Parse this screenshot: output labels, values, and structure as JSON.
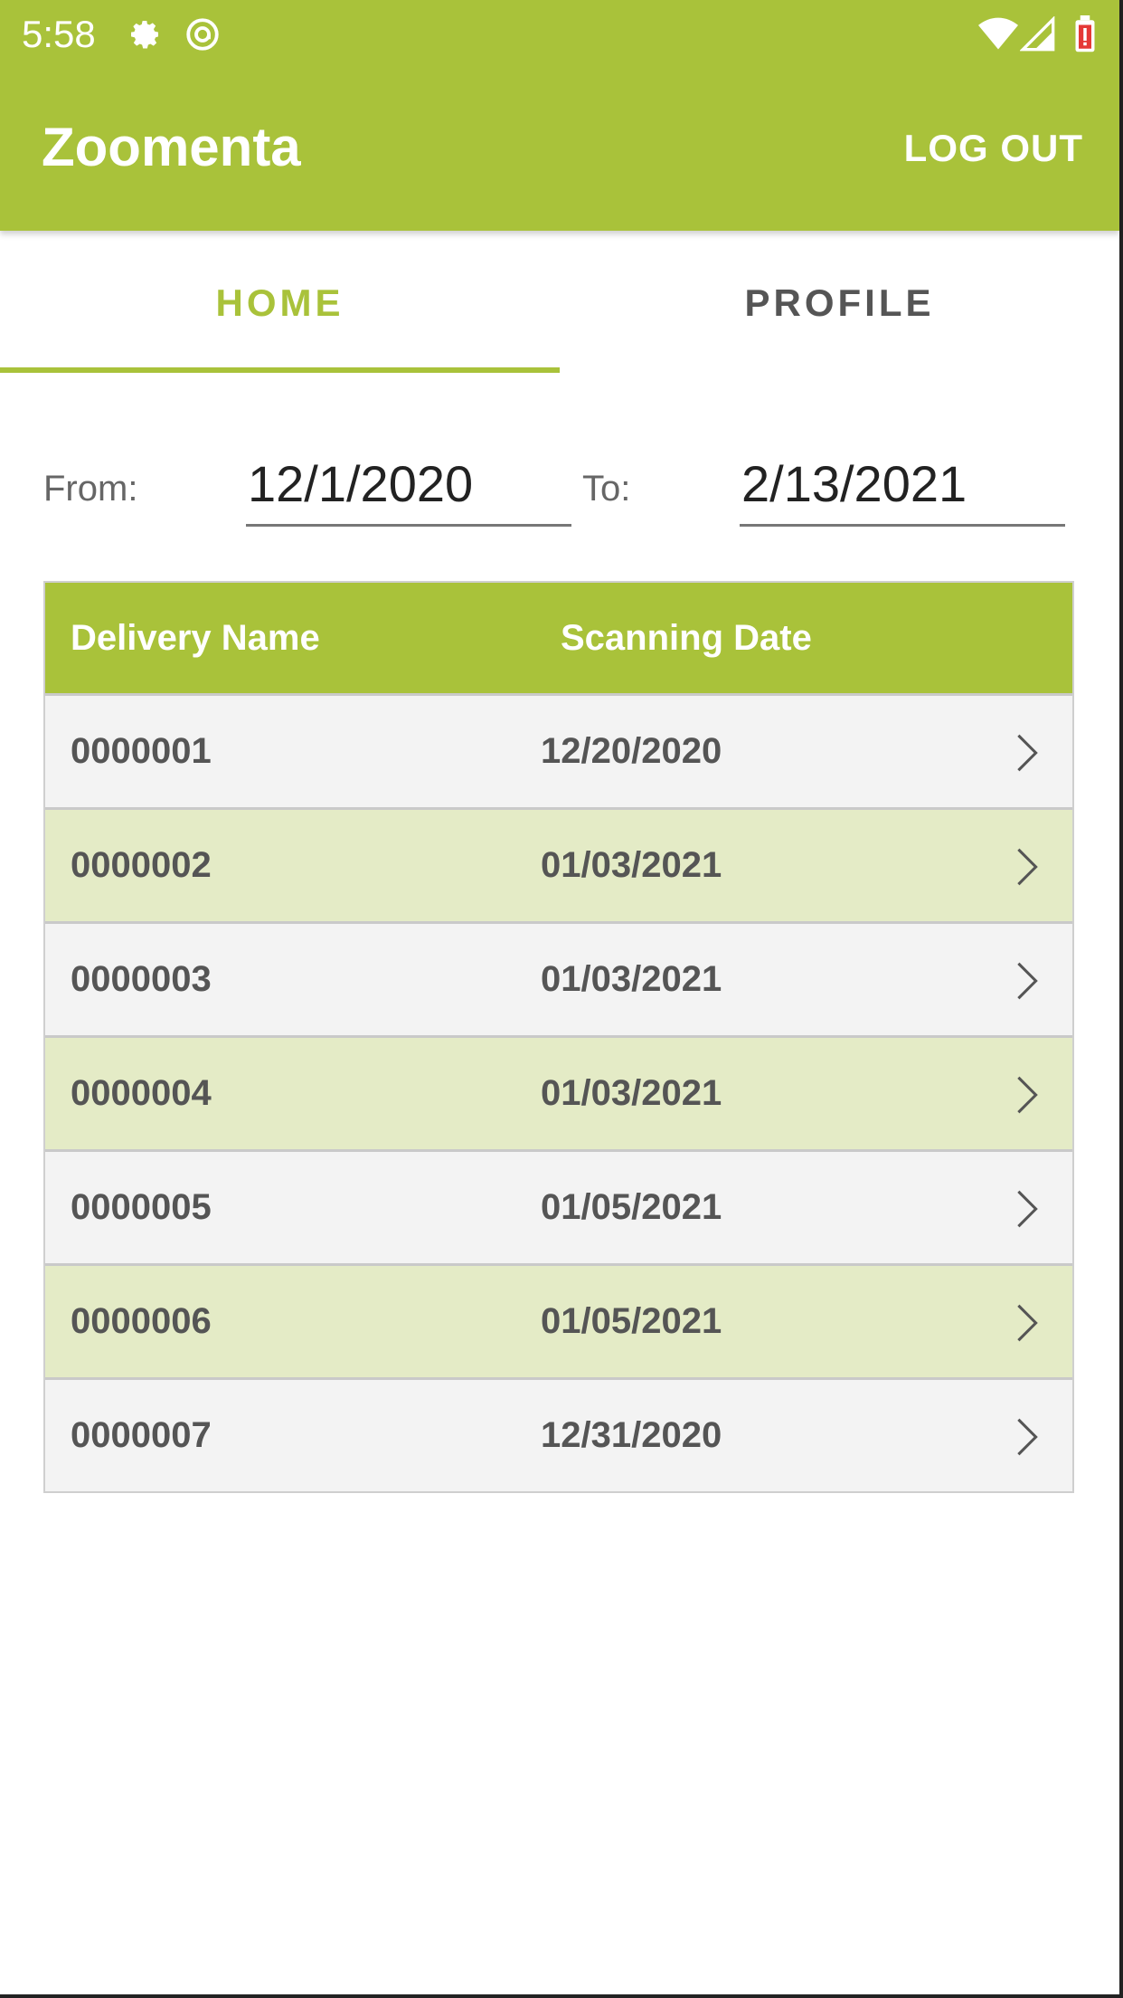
{
  "status_bar": {
    "time": "5:58",
    "icons": [
      "gear-icon",
      "sync-icon",
      "wifi-icon",
      "signal-icon",
      "battery-icon"
    ]
  },
  "app_bar": {
    "title": "Zoomenta",
    "logout_label": "LOG OUT",
    "color": "#a9c23a"
  },
  "tabs": [
    {
      "label": "HOME",
      "active": true
    },
    {
      "label": "PROFILE",
      "active": false
    }
  ],
  "filters": {
    "from_label": "From:",
    "from_value": "12/1/2020",
    "to_label": "To:",
    "to_value": "2/13/2021"
  },
  "table": {
    "headers": {
      "name": "Delivery Name",
      "date": "Scanning Date"
    },
    "rows": [
      {
        "name": "0000001",
        "date": "12/20/2020"
      },
      {
        "name": "0000002",
        "date": "01/03/2021"
      },
      {
        "name": "0000003",
        "date": "01/03/2021"
      },
      {
        "name": "0000004",
        "date": "01/03/2021"
      },
      {
        "name": "0000005",
        "date": "01/05/2021"
      },
      {
        "name": "0000006",
        "date": "01/05/2021"
      },
      {
        "name": "0000007",
        "date": "12/31/2020"
      }
    ],
    "row_icon": "chevron-right-icon",
    "colors": {
      "odd": "#f3f3f3",
      "even": "#e4ebc6"
    }
  }
}
